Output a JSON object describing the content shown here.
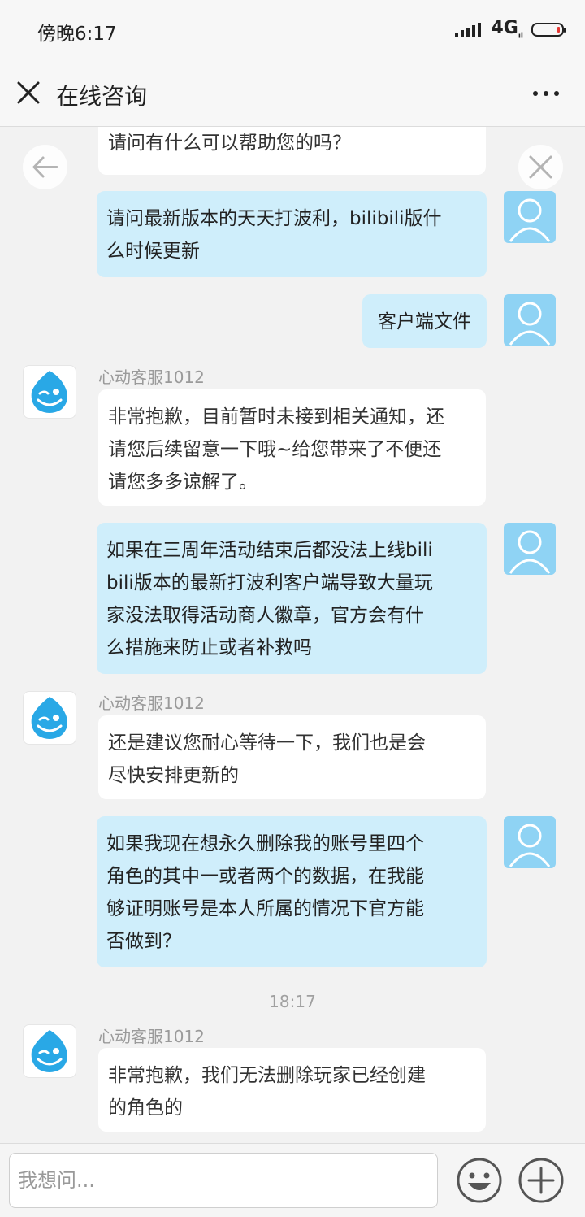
{
  "status_bar": {
    "time": "傍晚6:17",
    "network": "4G",
    "network_sub": "ıl"
  },
  "header": {
    "title": "在线咨询",
    "close_icon": "close-icon",
    "more_icon": "more-icon"
  },
  "chat": {
    "messages": [
      {
        "side": "left",
        "text": "请问有什么可以帮助您的吗？"
      },
      {
        "side": "right",
        "lines": [
          "请问最新版本的天天打波利，bilibili版什",
          "么时候更新"
        ]
      },
      {
        "side": "right",
        "text": "客户端文件"
      },
      {
        "side": "left",
        "sender": "心动客服1012",
        "lines": [
          "非常抱歉，目前暂时未接到相关通知，还",
          "请您后续留意一下哦~给您带来了不便还",
          "请您多多谅解了。"
        ]
      },
      {
        "side": "right",
        "lines": [
          "如果在三周年活动结束后都没法上线bili",
          "bili版本的最新打波利客户端导致大量玩",
          "家没法取得活动商人徽章，官方会有什",
          "么措施来防止或者补救吗"
        ]
      },
      {
        "side": "left",
        "sender": "心动客服1012",
        "lines": [
          "还是建议您耐心等待一下，我们也是会",
          "尽快安排更新的"
        ]
      },
      {
        "side": "right",
        "lines": [
          "如果我现在想永久删除我的账号里四个",
          "角色的其中一或者两个的数据，在我能",
          "够证明账号是本人所属的情况下官方能",
          "否做到？"
        ]
      },
      {
        "side": "time",
        "text": "18:17"
      },
      {
        "side": "left",
        "sender": "心动客服1012",
        "lines": [
          "非常抱歉，我们无法删除玩家已经创建",
          "的角色的"
        ]
      }
    ]
  },
  "input": {
    "placeholder": "我想问..."
  },
  "icons": {
    "emoji": "emoji-icon",
    "add": "plus-icon",
    "back": "arrow-left-icon"
  },
  "colors": {
    "right_bubble": "#cfeefb",
    "left_bubble": "#ffffff",
    "user_avatar": "#8fd3f4"
  }
}
